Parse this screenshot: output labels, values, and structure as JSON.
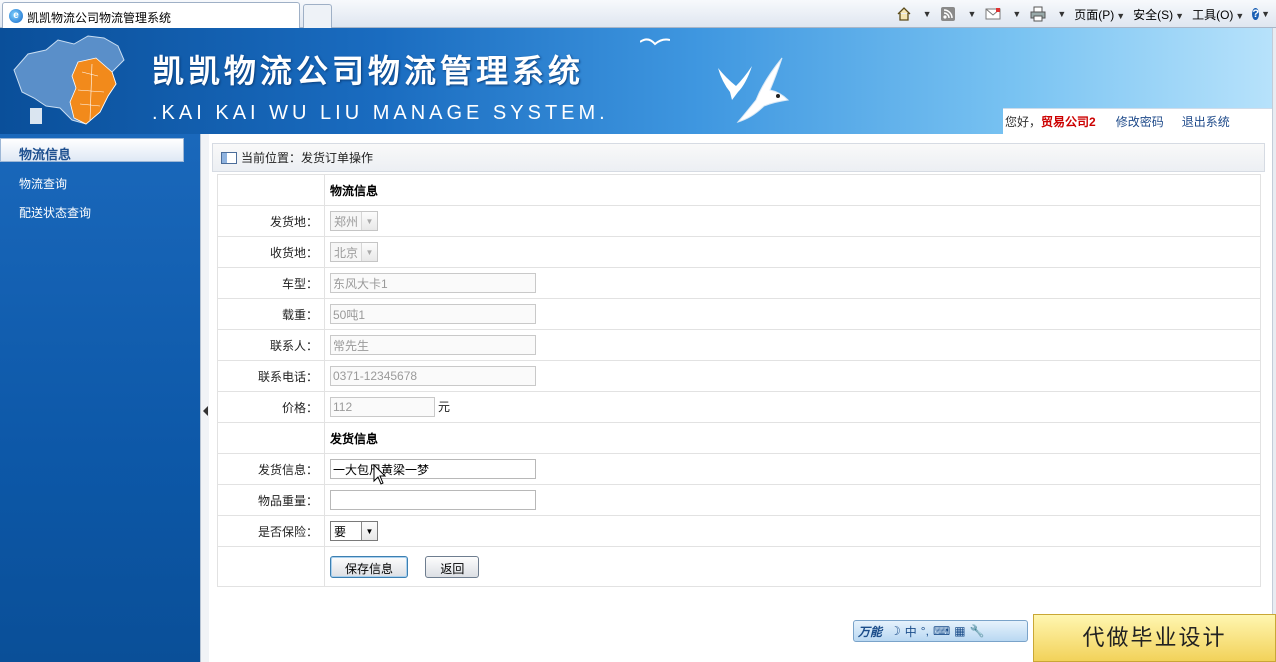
{
  "browser": {
    "tab_title": "凯凯物流公司物流管理系统",
    "commands": {
      "page": "页面(P)",
      "safety": "安全(S)",
      "tools": "工具(O)",
      "help": "?"
    }
  },
  "header": {
    "title": "凯凯物流公司物流管理系统",
    "subtitle": ".KAI KAI WU LIU MANAGE SYSTEM.",
    "greeting": "您好，",
    "username": "贸易公司2",
    "change_password": "修改密码",
    "logout": "退出系统"
  },
  "sidebar": {
    "section": "物流信息",
    "items": [
      {
        "label": "物流查询"
      },
      {
        "label": "配送状态查询"
      }
    ]
  },
  "breadcrumb": {
    "label": "当前位置：发货订单操作"
  },
  "form": {
    "section_logistics": "物流信息",
    "origin_label": "发货地：",
    "origin_value": "郑州",
    "dest_label": "收货地：",
    "dest_value": "北京",
    "vehicle_label": "车型：",
    "vehicle_value": "东风大卡1",
    "load_label": "载重：",
    "load_value": "50吨1",
    "contact_label": "联系人：",
    "contact_value": "常先生",
    "phone_label": "联系电话：",
    "phone_value": "0371-12345678",
    "price_label": "价格：",
    "price_value": "112",
    "price_unit": "元",
    "section_shipping": "发货信息",
    "shipping_info_label": "发货信息：",
    "shipping_info_value": "一大包尺黄梁一梦",
    "weight_label": "物品重量：",
    "weight_value": "",
    "insurance_label": "是否保险：",
    "insurance_value": "要",
    "save_label": "保存信息",
    "back_label": "返回"
  },
  "ime": {
    "brand": "万能",
    "lang": "中"
  },
  "ad": {
    "text": "代做毕业设计"
  }
}
